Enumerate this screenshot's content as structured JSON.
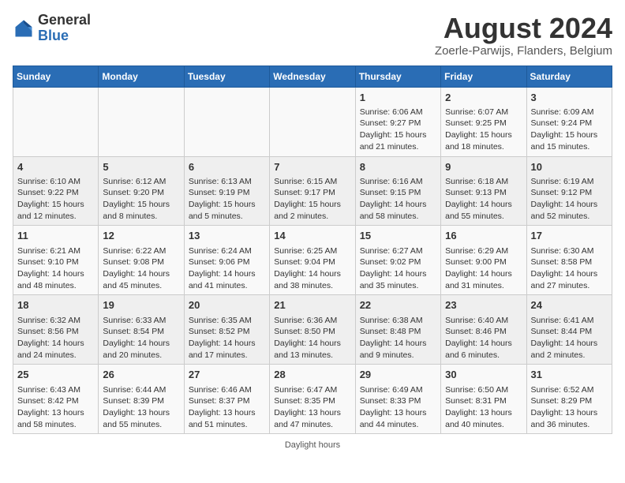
{
  "header": {
    "logo_general": "General",
    "logo_blue": "Blue",
    "month_title": "August 2024",
    "location": "Zoerle-Parwijs, Flanders, Belgium"
  },
  "days_of_week": [
    "Sunday",
    "Monday",
    "Tuesday",
    "Wednesday",
    "Thursday",
    "Friday",
    "Saturday"
  ],
  "footer": {
    "note": "Daylight hours"
  },
  "weeks": [
    {
      "days": [
        {
          "num": "",
          "info": ""
        },
        {
          "num": "",
          "info": ""
        },
        {
          "num": "",
          "info": ""
        },
        {
          "num": "",
          "info": ""
        },
        {
          "num": "1",
          "info": "Sunrise: 6:06 AM\nSunset: 9:27 PM\nDaylight: 15 hours\nand 21 minutes."
        },
        {
          "num": "2",
          "info": "Sunrise: 6:07 AM\nSunset: 9:25 PM\nDaylight: 15 hours\nand 18 minutes."
        },
        {
          "num": "3",
          "info": "Sunrise: 6:09 AM\nSunset: 9:24 PM\nDaylight: 15 hours\nand 15 minutes."
        }
      ]
    },
    {
      "days": [
        {
          "num": "4",
          "info": "Sunrise: 6:10 AM\nSunset: 9:22 PM\nDaylight: 15 hours\nand 12 minutes."
        },
        {
          "num": "5",
          "info": "Sunrise: 6:12 AM\nSunset: 9:20 PM\nDaylight: 15 hours\nand 8 minutes."
        },
        {
          "num": "6",
          "info": "Sunrise: 6:13 AM\nSunset: 9:19 PM\nDaylight: 15 hours\nand 5 minutes."
        },
        {
          "num": "7",
          "info": "Sunrise: 6:15 AM\nSunset: 9:17 PM\nDaylight: 15 hours\nand 2 minutes."
        },
        {
          "num": "8",
          "info": "Sunrise: 6:16 AM\nSunset: 9:15 PM\nDaylight: 14 hours\nand 58 minutes."
        },
        {
          "num": "9",
          "info": "Sunrise: 6:18 AM\nSunset: 9:13 PM\nDaylight: 14 hours\nand 55 minutes."
        },
        {
          "num": "10",
          "info": "Sunrise: 6:19 AM\nSunset: 9:12 PM\nDaylight: 14 hours\nand 52 minutes."
        }
      ]
    },
    {
      "days": [
        {
          "num": "11",
          "info": "Sunrise: 6:21 AM\nSunset: 9:10 PM\nDaylight: 14 hours\nand 48 minutes."
        },
        {
          "num": "12",
          "info": "Sunrise: 6:22 AM\nSunset: 9:08 PM\nDaylight: 14 hours\nand 45 minutes."
        },
        {
          "num": "13",
          "info": "Sunrise: 6:24 AM\nSunset: 9:06 PM\nDaylight: 14 hours\nand 41 minutes."
        },
        {
          "num": "14",
          "info": "Sunrise: 6:25 AM\nSunset: 9:04 PM\nDaylight: 14 hours\nand 38 minutes."
        },
        {
          "num": "15",
          "info": "Sunrise: 6:27 AM\nSunset: 9:02 PM\nDaylight: 14 hours\nand 35 minutes."
        },
        {
          "num": "16",
          "info": "Sunrise: 6:29 AM\nSunset: 9:00 PM\nDaylight: 14 hours\nand 31 minutes."
        },
        {
          "num": "17",
          "info": "Sunrise: 6:30 AM\nSunset: 8:58 PM\nDaylight: 14 hours\nand 27 minutes."
        }
      ]
    },
    {
      "days": [
        {
          "num": "18",
          "info": "Sunrise: 6:32 AM\nSunset: 8:56 PM\nDaylight: 14 hours\nand 24 minutes."
        },
        {
          "num": "19",
          "info": "Sunrise: 6:33 AM\nSunset: 8:54 PM\nDaylight: 14 hours\nand 20 minutes."
        },
        {
          "num": "20",
          "info": "Sunrise: 6:35 AM\nSunset: 8:52 PM\nDaylight: 14 hours\nand 17 minutes."
        },
        {
          "num": "21",
          "info": "Sunrise: 6:36 AM\nSunset: 8:50 PM\nDaylight: 14 hours\nand 13 minutes."
        },
        {
          "num": "22",
          "info": "Sunrise: 6:38 AM\nSunset: 8:48 PM\nDaylight: 14 hours\nand 9 minutes."
        },
        {
          "num": "23",
          "info": "Sunrise: 6:40 AM\nSunset: 8:46 PM\nDaylight: 14 hours\nand 6 minutes."
        },
        {
          "num": "24",
          "info": "Sunrise: 6:41 AM\nSunset: 8:44 PM\nDaylight: 14 hours\nand 2 minutes."
        }
      ]
    },
    {
      "days": [
        {
          "num": "25",
          "info": "Sunrise: 6:43 AM\nSunset: 8:42 PM\nDaylight: 13 hours\nand 58 minutes."
        },
        {
          "num": "26",
          "info": "Sunrise: 6:44 AM\nSunset: 8:39 PM\nDaylight: 13 hours\nand 55 minutes."
        },
        {
          "num": "27",
          "info": "Sunrise: 6:46 AM\nSunset: 8:37 PM\nDaylight: 13 hours\nand 51 minutes."
        },
        {
          "num": "28",
          "info": "Sunrise: 6:47 AM\nSunset: 8:35 PM\nDaylight: 13 hours\nand 47 minutes."
        },
        {
          "num": "29",
          "info": "Sunrise: 6:49 AM\nSunset: 8:33 PM\nDaylight: 13 hours\nand 44 minutes."
        },
        {
          "num": "30",
          "info": "Sunrise: 6:50 AM\nSunset: 8:31 PM\nDaylight: 13 hours\nand 40 minutes."
        },
        {
          "num": "31",
          "info": "Sunrise: 6:52 AM\nSunset: 8:29 PM\nDaylight: 13 hours\nand 36 minutes."
        }
      ]
    }
  ]
}
